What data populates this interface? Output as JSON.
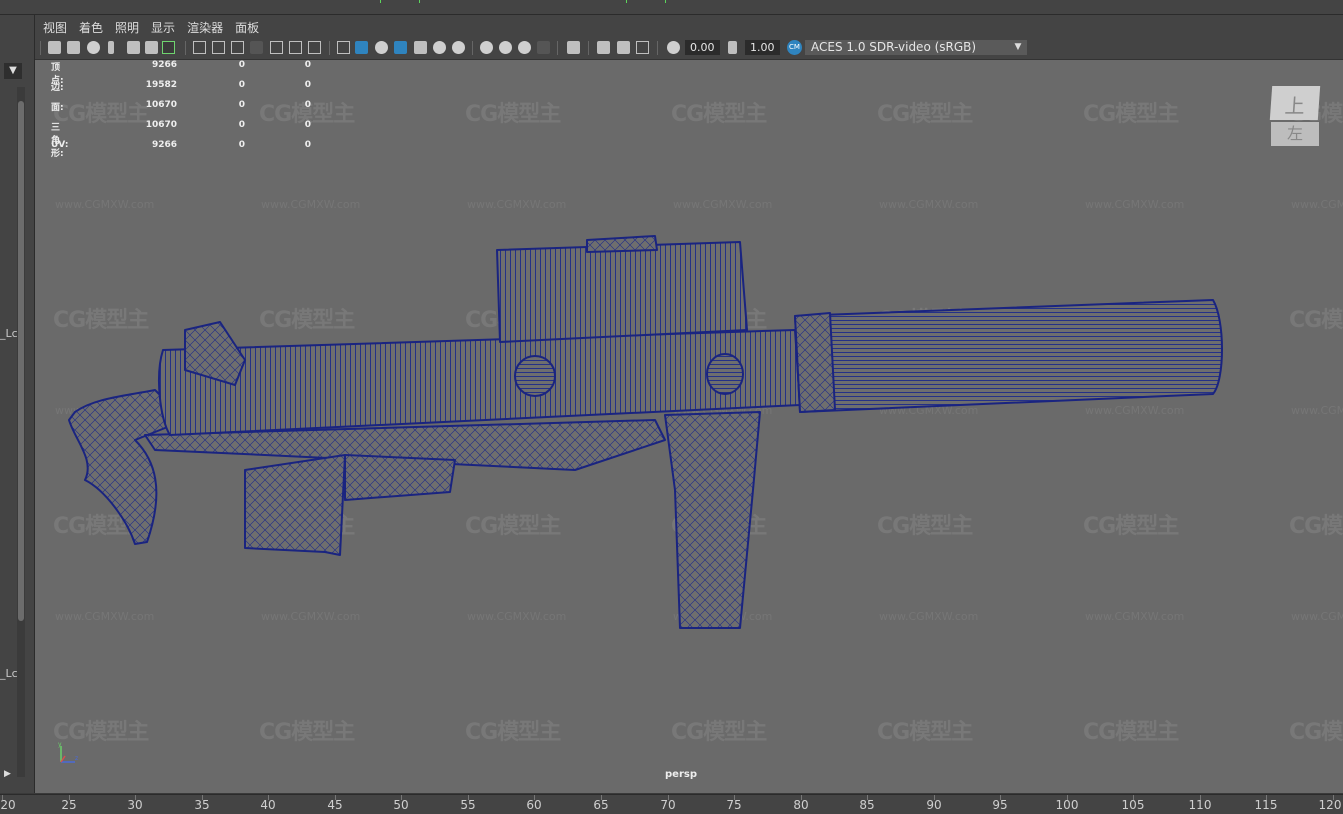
{
  "menu": [
    "视图",
    "着色",
    "照明",
    "显示",
    "渲染器",
    "面板"
  ],
  "toolbar": {
    "value_a": "0.00",
    "value_b": "1.00",
    "color_space": "ACES 1.0 SDR-video (sRGB)",
    "icons": [
      "camera-icon",
      "camera-attributes-icon",
      "bookmark-icon",
      "image-plane-icon",
      "grid-icon",
      "film-gate-icon",
      "resolution-gate-icon",
      "wireframe-icon",
      "smooth-shade-icon",
      "textured-icon",
      "lights-icon",
      "shadows-icon",
      "ambient-occlusion-icon",
      "isolate-select-icon",
      "xray-icon",
      "exposure-icon",
      "gamma-icon",
      "color-management-icon"
    ]
  },
  "hud": {
    "rows": [
      {
        "label": "顶点:",
        "v1": "9266",
        "v2": "0",
        "v3": "0"
      },
      {
        "label": "边:",
        "v1": "19582",
        "v2": "0",
        "v3": "0"
      },
      {
        "label": "面:",
        "v1": "10670",
        "v2": "0",
        "v3": "0"
      },
      {
        "label": "三角形:",
        "v1": "10670",
        "v2": "0",
        "v3": "0"
      },
      {
        "label": "UV:",
        "v1": "9266",
        "v2": "0",
        "v3": "0"
      }
    ]
  },
  "viewcube": {
    "top": "上",
    "front": "左"
  },
  "camera_name": "persp",
  "left_panel": {
    "label_1": "_Lc",
    "label_2": "_Lc"
  },
  "watermark": {
    "logo": "CG模型主",
    "url": "www.CGMXW.com"
  },
  "ruler": [
    "20",
    "25",
    "30",
    "35",
    "40",
    "45",
    "50",
    "55",
    "60",
    "65",
    "70",
    "75",
    "80",
    "85",
    "90",
    "95",
    "100",
    "105",
    "110",
    "115",
    "120"
  ],
  "colors": {
    "wireframe": "#1c2a8a",
    "viewport_bg": "#6a6a6a",
    "accent": "#2f84bf"
  }
}
